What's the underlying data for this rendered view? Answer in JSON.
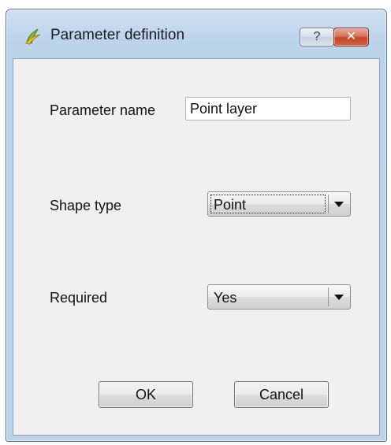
{
  "window": {
    "title": "Parameter definition",
    "help_label": "?",
    "close_label": "✕",
    "app_icon": "qgis-icon"
  },
  "form": {
    "parameter_name": {
      "label": "Parameter name",
      "value": "Point layer"
    },
    "shape_type": {
      "label": "Shape type",
      "selected": "Point"
    },
    "required": {
      "label": "Required",
      "selected": "Yes"
    }
  },
  "buttons": {
    "ok": "OK",
    "cancel": "Cancel"
  },
  "colors": {
    "frame": "#bdd3ea",
    "client": "#f0f0f0",
    "close_button": "#c4432a"
  }
}
